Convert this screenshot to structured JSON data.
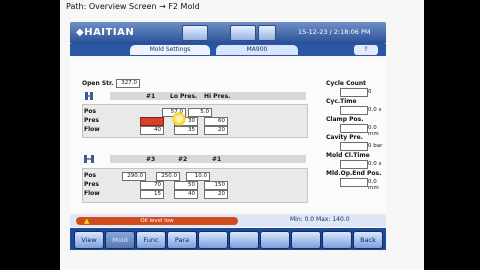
{
  "path_caption": "Path: Overview Screen → F2 Mold",
  "header": {
    "logo": "HAITIAN",
    "btn1": "",
    "btn2": "",
    "btn3": "",
    "datetime": "15-12-23 / 2:18:06 PM"
  },
  "tabs": {
    "active": "Mold Settings",
    "other": "MA900",
    "nav": "?"
  },
  "mold": {
    "open_str_label": "Open Str.",
    "open_str_value": "327.0",
    "close": {
      "headers": [
        "#1",
        "Lo Pres.",
        "Hi Pres."
      ],
      "rows": [
        {
          "label": "Pos",
          "values": [
            "57.0",
            "5.0"
          ]
        },
        {
          "label": "Pres",
          "values": [
            "",
            "30",
            "60"
          ]
        },
        {
          "label": "Flow",
          "values": [
            "40",
            "35",
            "20"
          ]
        }
      ]
    },
    "open": {
      "headers": [
        "#3",
        "#2",
        "#1"
      ],
      "rows": [
        {
          "label": "Pos",
          "values": [
            "290.0",
            "250.0",
            "10.0"
          ]
        },
        {
          "label": "Pres",
          "values": [
            "70",
            "50",
            "150"
          ]
        },
        {
          "label": "Flow",
          "values": [
            "15",
            "40",
            "20"
          ]
        }
      ]
    }
  },
  "right_panel": [
    {
      "label": "Cycle Count",
      "unit": "0"
    },
    {
      "label": "Cyc.Time",
      "unit": "0.0 s"
    },
    {
      "label": "Clamp Pos.",
      "unit": "0.0 mm"
    },
    {
      "label": "Cavity Pre.",
      "unit": "0 bar"
    },
    {
      "label": "Mold Cl.Time",
      "unit": "0.0 s"
    },
    {
      "label": "Mld.Op.End Pos.",
      "unit": "0.0 mm"
    }
  ],
  "alarm": {
    "text": "Oil level low",
    "minmax": "Min: 0.0 Max: 140.0"
  },
  "bottom_buttons": [
    "View",
    "Mold",
    "Func",
    "Para",
    "",
    "",
    "",
    "",
    "",
    "Back"
  ],
  "colors": {
    "brand_blue": "#274e96",
    "alarm_red": "#d24b1f",
    "field_red": "#d8402c"
  }
}
